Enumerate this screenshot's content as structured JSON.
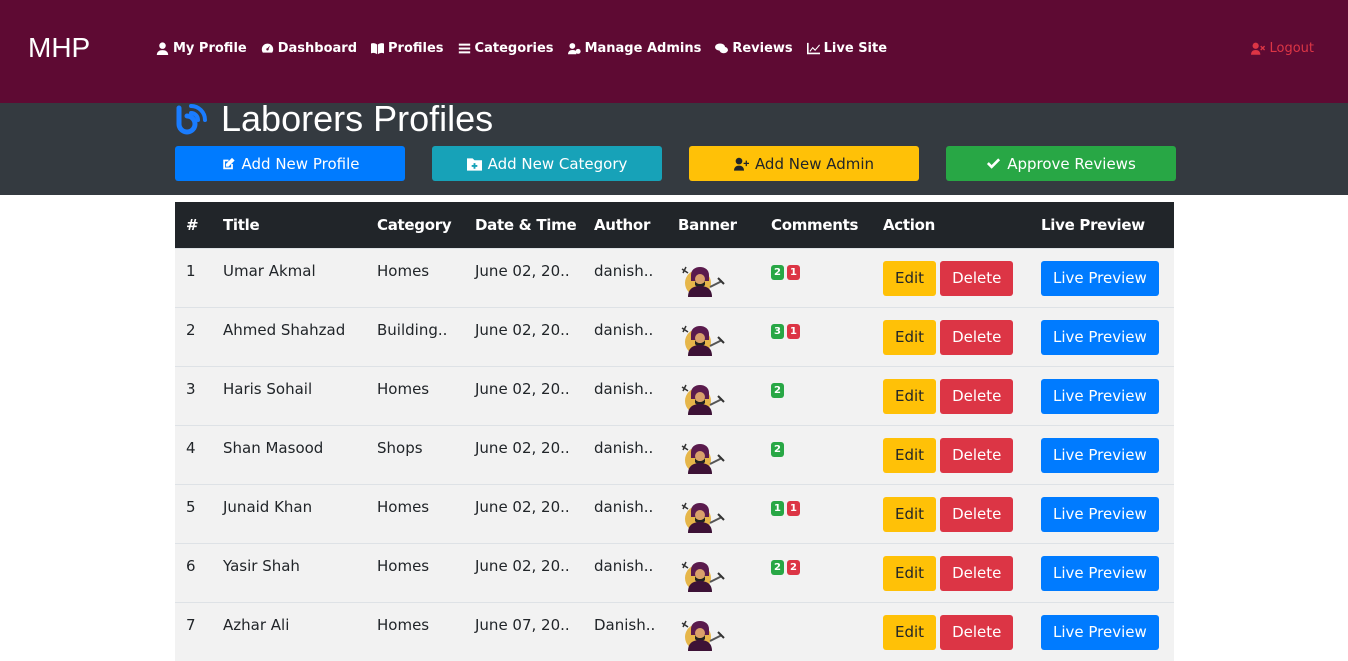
{
  "nav": {
    "brand": "MHP",
    "links": [
      {
        "label": "My Profile",
        "icon": "user-icon"
      },
      {
        "label": "Dashboard",
        "icon": "dashboard-icon"
      },
      {
        "label": "Profiles",
        "icon": "book-icon"
      },
      {
        "label": "Categories",
        "icon": "list-icon"
      },
      {
        "label": "Manage Admins",
        "icon": "user-cog-icon"
      },
      {
        "label": "Reviews",
        "icon": "comments-icon"
      },
      {
        "label": "Live Site",
        "icon": "chart-icon"
      }
    ],
    "logout": "Logout"
  },
  "header": {
    "title": "Laborers Profiles",
    "actions": {
      "add_profile": "Add New Profile",
      "add_category": "Add New Category",
      "add_admin": "Add New Admin",
      "approve_reviews": "Approve Reviews"
    }
  },
  "table": {
    "columns": {
      "num": "#",
      "title": "Title",
      "category": "Category",
      "datetime": "Date & Time",
      "author": "Author",
      "banner": "Banner",
      "comments": "Comments",
      "action": "Action",
      "live": "Live Preview"
    },
    "edit_label": "Edit",
    "delete_label": "Delete",
    "preview_label": "Live Preview",
    "rows": [
      {
        "num": "1",
        "title": "Umar Akmal",
        "category": "Homes",
        "datetime": "June 02, 20..",
        "author": "danish..",
        "approved": "2",
        "pending": "1"
      },
      {
        "num": "2",
        "title": "Ahmed Shahzad",
        "category": "Building..",
        "datetime": "June 02, 20..",
        "author": "danish..",
        "approved": "3",
        "pending": "1"
      },
      {
        "num": "3",
        "title": "Haris Sohail",
        "category": "Homes",
        "datetime": "June 02, 20..",
        "author": "danish..",
        "approved": "2",
        "pending": ""
      },
      {
        "num": "4",
        "title": "Shan Masood",
        "category": "Shops",
        "datetime": "June 02, 20..",
        "author": "danish..",
        "approved": "2",
        "pending": ""
      },
      {
        "num": "5",
        "title": "Junaid Khan",
        "category": "Homes",
        "datetime": "June 02, 20..",
        "author": "danish..",
        "approved": "1",
        "pending": "1"
      },
      {
        "num": "6",
        "title": "Yasir Shah",
        "category": "Homes",
        "datetime": "June 02, 20..",
        "author": "danish..",
        "approved": "2",
        "pending": "2"
      },
      {
        "num": "7",
        "title": "Azhar Ali",
        "category": "Homes",
        "datetime": "June 07, 20..",
        "author": "Danish..",
        "approved": "",
        "pending": ""
      }
    ]
  },
  "colors": {
    "nav_bg": "#5e0a33",
    "band_bg": "#343a40",
    "primary": "#007bff",
    "info": "#17a2b8",
    "warning": "#ffc107",
    "success": "#28a745",
    "danger": "#dc3545"
  }
}
